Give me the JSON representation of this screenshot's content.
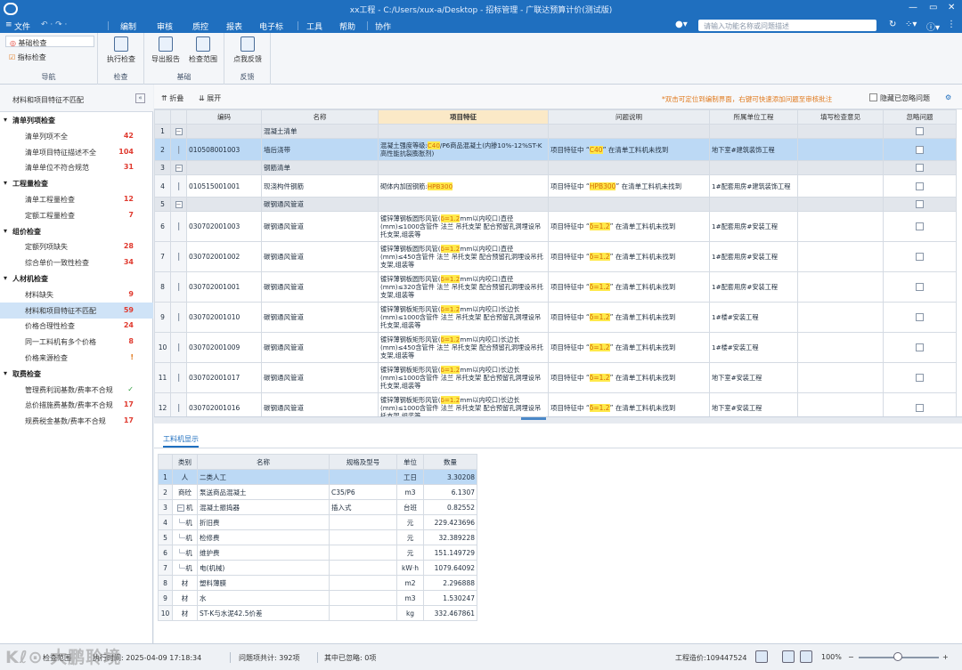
{
  "titlebar": {
    "title": "xx工程 - C:/Users/xux-a/Desktop - 招标管理 - 广联达预算计价(测试版)"
  },
  "menu": {
    "items": [
      "文件",
      "编制",
      "审核",
      "质控",
      "报表",
      "电子标",
      "工具",
      "帮助",
      "协作"
    ],
    "active": "质控",
    "search_placeholder": "请输入功能名称或问题描述"
  },
  "ribbon": {
    "nav": {
      "items": [
        "基础检查",
        "指标检查"
      ],
      "group_label": "导航"
    },
    "check": {
      "button": "执行检查",
      "group_label": "检查"
    },
    "base": {
      "buttons": [
        "导出报告",
        "检查范围"
      ],
      "group_label": "基础"
    },
    "feedback": {
      "button": "点我反馈",
      "group_label": "反馈"
    }
  },
  "left_panel": {
    "title": "材料和项目特征不匹配",
    "collapse_glyph": "«",
    "rows": [
      {
        "type": "cat",
        "label": "清单列项检查"
      },
      {
        "type": "sub",
        "label": "清单列项不全",
        "count": "42"
      },
      {
        "type": "sub",
        "label": "清单项目特征描述不全",
        "count": "104"
      },
      {
        "type": "sub",
        "label": "清单单位不符合规范",
        "count": "31"
      },
      {
        "type": "cat",
        "label": "工程量检查"
      },
      {
        "type": "sub",
        "label": "清单工程量检查",
        "count": "12"
      },
      {
        "type": "sub",
        "label": "定额工程量检查",
        "count": "7"
      },
      {
        "type": "cat",
        "label": "组价检查"
      },
      {
        "type": "sub",
        "label": "定额列项缺失",
        "count": "28"
      },
      {
        "type": "sub",
        "label": "综合单价一致性检查",
        "count": "34"
      },
      {
        "type": "cat",
        "label": "人材机检查"
      },
      {
        "type": "sub",
        "label": "材料缺失",
        "count": "9"
      },
      {
        "type": "sub",
        "label": "材料和项目特征不匹配",
        "count": "59",
        "selected": true
      },
      {
        "type": "sub",
        "label": "价格合理性检查",
        "count": "24"
      },
      {
        "type": "sub",
        "label": "同一工料机有多个价格",
        "count": "8"
      },
      {
        "type": "sub",
        "label": "价格来源检查",
        "count": "!",
        "style": "warn"
      },
      {
        "type": "cat",
        "label": "取费检查"
      },
      {
        "type": "sub",
        "label": "管理费利润基数/费率不合规",
        "count": "✓",
        "style": "ok"
      },
      {
        "type": "sub",
        "label": "总价措施费基数/费率不合规",
        "count": "17"
      },
      {
        "type": "sub",
        "label": "规费税金基数/费率不合规",
        "count": "17"
      }
    ]
  },
  "toolbar": {
    "fold": "折叠",
    "expand": "展开",
    "hint": "*双击可定位到编制界面，右键可快速添加问题至审核批注",
    "hide_label": "隐藏已忽略问题"
  },
  "grid": {
    "columns": [
      "编码",
      "名称",
      "项目特征",
      "问题说明",
      "所属单位工程",
      "填写检查意见",
      "忽略问题"
    ],
    "rows": [
      {
        "n": "1",
        "kind": "grp",
        "name": "混凝土清单"
      },
      {
        "n": "2",
        "kind": "r1",
        "selected": true,
        "code": "010508001003",
        "name": "墙后浇带",
        "feat": [
          "混凝土强度等级:",
          "C40",
          "/P6商品混凝土(内掺10%-12%ST-K高性能抗裂膨胀剂)"
        ],
        "issue": [
          "项目特征中 “",
          "C40",
          "” 在清单工料机未找到"
        ],
        "unit": "地下室#建筑装饰工程"
      },
      {
        "n": "3",
        "kind": "grp",
        "name": "钢筋清单"
      },
      {
        "n": "4",
        "kind": "r1",
        "code": "010515001001",
        "name": "现浇构件钢筋",
        "feat": [
          "砌体内加固钢筋:",
          "HPB300",
          ""
        ],
        "issue": [
          "项目特征中 “",
          "HPB300",
          "” 在清单工料机未找到"
        ],
        "unit": "1#配套用房#建筑装饰工程"
      },
      {
        "n": "5",
        "kind": "grp",
        "name": "碳钢通风管道"
      },
      {
        "n": "6",
        "kind": "r2",
        "code": "030702001003",
        "name": "碳钢通风管道",
        "feat": [
          "镀锌薄钢板圆形风管(",
          "δ=1.2",
          "mm以内咬口)直径(mm)≤1000含管件 法兰 吊托支架 配合预留孔洞埋设吊托支架,组装等"
        ],
        "issue": [
          "项目特征中 “",
          "δ=1.2",
          "” 在清单工料机未找到"
        ],
        "unit": "1#配套用房#安装工程"
      },
      {
        "n": "7",
        "kind": "r2",
        "code": "030702001002",
        "name": "碳钢通风管道",
        "feat": [
          "镀锌薄钢板圆形风管(",
          "δ=1.2",
          "mm以内咬口)直径(mm)≤450含管件 法兰 吊托支架 配合预留孔洞埋设吊托支架,组装等"
        ],
        "issue": [
          "项目特征中 “",
          "δ=1.2",
          "” 在清单工料机未找到"
        ],
        "unit": "1#配套用房#安装工程"
      },
      {
        "n": "8",
        "kind": "r2",
        "code": "030702001001",
        "name": "碳钢通风管道",
        "feat": [
          "镀锌薄钢板圆形风管(",
          "δ=1.2",
          "mm以内咬口)直径(mm)≤320含管件 法兰 吊托支架 配合预留孔洞埋设吊托支架,组装等"
        ],
        "issue": [
          "项目特征中 “",
          "δ=1.2",
          "” 在清单工料机未找到"
        ],
        "unit": "1#配套用房#安装工程"
      },
      {
        "n": "9",
        "kind": "r2",
        "code": "030702001010",
        "name": "碳钢通风管道",
        "feat": [
          "镀锌薄钢板矩形风管(",
          "δ=1.2",
          "mm以内咬口)长边长(mm)≤1000含管件 法兰 吊托支架 配合预留孔洞埋设吊托支架,组装等"
        ],
        "issue": [
          "项目特征中 “",
          "δ=1.2",
          "” 在清单工料机未找到"
        ],
        "unit": "1#楼#安装工程"
      },
      {
        "n": "10",
        "kind": "r2",
        "code": "030702001009",
        "name": "碳钢通风管道",
        "feat": [
          "镀锌薄钢板矩形风管(",
          "δ=1.2",
          "mm以内咬口)长边长(mm)≤450含管件 法兰 吊托支架 配合预留孔洞埋设吊托支架,组装等"
        ],
        "issue": [
          "项目特征中 “",
          "δ=1.2",
          "” 在清单工料机未找到"
        ],
        "unit": "1#楼#安装工程"
      },
      {
        "n": "11",
        "kind": "r2",
        "code": "030702001017",
        "name": "碳钢通风管道",
        "feat": [
          "镀锌薄钢板矩形风管(",
          "δ=1.2",
          "mm以内咬口)长边长(mm)≤1000含管件 法兰 吊托支架 配合预留孔洞埋设吊托支架,组装等"
        ],
        "issue": [
          "项目特征中 “",
          "δ=1.2",
          "” 在清单工料机未找到"
        ],
        "unit": "地下室#安装工程"
      },
      {
        "n": "12",
        "kind": "r2",
        "code": "030702001016",
        "name": "碳钢通风管道",
        "feat": [
          "镀锌薄钢板矩形风管(",
          "δ=1.2",
          "mm以内咬口)长边长(mm)≤1000含管件 法兰 吊托支架 配合预留孔洞埋设吊托支架,组装等"
        ],
        "issue": [
          "项目特征中 “",
          "δ=1.2",
          "” 在清单工料机未找到"
        ],
        "unit": "地下室#安装工程"
      }
    ]
  },
  "lower": {
    "tab": "工料机显示",
    "columns": [
      "类别",
      "名称",
      "规格及型号",
      "单位",
      "数量"
    ],
    "rows": [
      {
        "n": "1",
        "type": "人",
        "name": "二类人工",
        "spec": "",
        "unit": "工日",
        "qty": "3.30208",
        "selected": true
      },
      {
        "n": "2",
        "type": "商砼",
        "name": "泵送商品混凝土",
        "spec": "C35/P6",
        "unit": "m3",
        "qty": "6.1307"
      },
      {
        "n": "3",
        "type": "机",
        "name": "混凝土振捣器",
        "spec": "插入式",
        "unit": "台班",
        "qty": "0.82552",
        "toggle": "−"
      },
      {
        "n": "4",
        "type": "机",
        "name": "折旧费",
        "spec": "",
        "unit": "元",
        "qty": "229.423696",
        "child": true
      },
      {
        "n": "5",
        "type": "机",
        "name": "检修费",
        "spec": "",
        "unit": "元",
        "qty": "32.389228",
        "child": true
      },
      {
        "n": "6",
        "type": "机",
        "name": "维护费",
        "spec": "",
        "unit": "元",
        "qty": "151.149729",
        "child": true
      },
      {
        "n": "7",
        "type": "机",
        "name": "电(机械)",
        "spec": "",
        "unit": "kW·h",
        "qty": "1079.64092",
        "child": true
      },
      {
        "n": "8",
        "type": "材",
        "name": "塑料薄膜",
        "spec": "",
        "unit": "m2",
        "qty": "2.296888"
      },
      {
        "n": "9",
        "type": "材",
        "name": "水",
        "spec": "",
        "unit": "m3",
        "qty": "1.530247"
      },
      {
        "n": "10",
        "type": "材",
        "name": "ST-K与水泥42.5价差",
        "spec": "",
        "unit": "kg",
        "qty": "332.467861"
      }
    ]
  },
  "status": {
    "range": "检查范围",
    "time": "执行时间: 2025-04-09 17:18:34",
    "total": "问题项共计: 392项",
    "ignored": "其中已忽略: 0项",
    "cost": "工程造价:109447524",
    "zoom": "100%"
  },
  "watermark": "大鹏聆境"
}
